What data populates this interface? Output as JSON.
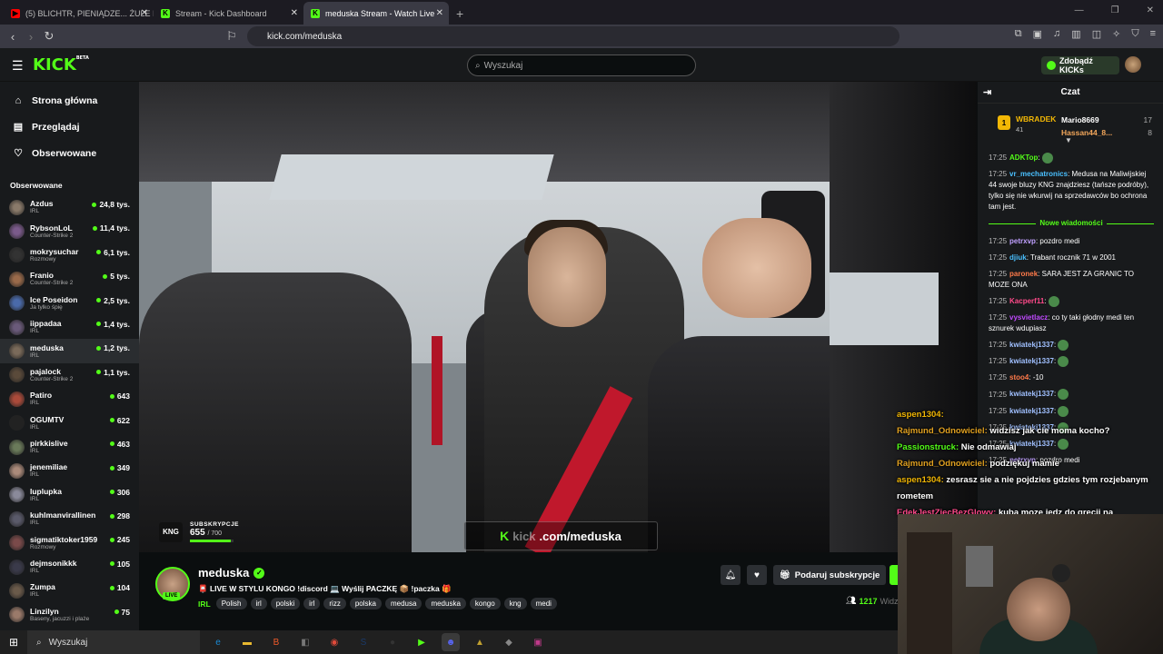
{
  "browser": {
    "tabs": [
      {
        "title": "(5) BLICHTR, PIENIĄDZE... ŻULE I BRU",
        "fav": "▶",
        "color": "#ff0000"
      },
      {
        "title": "Stream - Kick Dashboard",
        "fav": "K",
        "color": "#53fc18"
      },
      {
        "title": "meduska Stream - Watch Live",
        "fav": "K",
        "color": "#53fc18"
      }
    ],
    "url": "kick.com/meduska"
  },
  "header": {
    "search_placeholder": "Wyszukaj",
    "kicks_button": "Zdobądź KICKs"
  },
  "sidebar": {
    "nav": [
      {
        "label": "Strona główna",
        "icon": "home-icon",
        "glyph": "⌂"
      },
      {
        "label": "Przeglądaj",
        "icon": "browse-icon",
        "glyph": "▤"
      },
      {
        "label": "Obserwowane",
        "icon": "heart-icon",
        "glyph": "♡"
      }
    ],
    "section_title": "Obserwowane",
    "followed": [
      {
        "name": "Azdus",
        "category": "IRL",
        "viewers": "24,8 tys.",
        "color": "#8a7a6a"
      },
      {
        "name": "RybsonLoL",
        "category": "Counter-Strike 2",
        "viewers": "11,4 tys.",
        "color": "#7a5a8a"
      },
      {
        "name": "mokrysuchar",
        "category": "Rozmowy",
        "viewers": "6,1 tys.",
        "color": "#333"
      },
      {
        "name": "Franio",
        "category": "Counter-Strike 2",
        "viewers": "5 tys.",
        "color": "#9a6a4a"
      },
      {
        "name": "Ice Poseidon",
        "category": "Ja tylko śpię",
        "viewers": "2,5 tys.",
        "color": "#4a6aaa"
      },
      {
        "name": "iippadaa",
        "category": "IRL",
        "viewers": "1,4 tys.",
        "color": "#6a5a7a"
      },
      {
        "name": "meduska",
        "category": "IRL",
        "viewers": "1,2 tys.",
        "color": "#7a6a5a"
      },
      {
        "name": "pajalock",
        "category": "Counter-Strike 2",
        "viewers": "1,1 tys.",
        "color": "#5a4a3a"
      },
      {
        "name": "Patiro",
        "category": "IRL",
        "viewers": "643",
        "color": "#aa4a3a"
      },
      {
        "name": "OGUMTV",
        "category": "IRL",
        "viewers": "622",
        "color": "#222"
      },
      {
        "name": "pirkkislive",
        "category": "IRL",
        "viewers": "463",
        "color": "#6a7a5a"
      },
      {
        "name": "jenemiliae",
        "category": "IRL",
        "viewers": "349",
        "color": "#aa8a7a"
      },
      {
        "name": "luplupka",
        "category": "IRL",
        "viewers": "306",
        "color": "#8a8a9a"
      },
      {
        "name": "kuhlmanvirallinen",
        "category": "IRL",
        "viewers": "298",
        "color": "#5a5a6a"
      },
      {
        "name": "sigmatiktoker1959",
        "category": "Rozmowy",
        "viewers": "245",
        "color": "#7a4a4a"
      },
      {
        "name": "dejmsonikkk",
        "category": "IRL",
        "viewers": "105",
        "color": "#3a3a4a"
      },
      {
        "name": "Zumpa",
        "category": "IRL",
        "viewers": "104",
        "color": "#6a5a4a"
      },
      {
        "name": "Linzilyn",
        "category": "Baseny, jacuzzi i plaże",
        "viewers": "75",
        "color": "#9a7a6a"
      },
      {
        "name": "LittleElena",
        "category": "IRL",
        "viewers": "74",
        "color": "#aa7a8a"
      }
    ],
    "selected": "meduska"
  },
  "player": {
    "sub_widget_label": "SUBSKRYPCJE",
    "sub_logo": "KNG",
    "sub_current": "655",
    "sub_goal": "700",
    "sub_fraction": 0.936,
    "watermark_prefix": "kick",
    "watermark_text": ".com/meduska",
    "overlay_chat": [
      {
        "user": "aspen1304",
        "text": "",
        "color": "#f2b705"
      },
      {
        "user": "Rajmund_Odnowiciel",
        "text": "widzisz jak cie moma kocho?",
        "color": "#e0a020"
      },
      {
        "user": "Passionstruck",
        "text": "Nie odmawiaj",
        "color": "#53fc18"
      },
      {
        "user": "Rajmund_Odnowiciel",
        "text": "podziękuj mamie",
        "color": "#e0a020"
      },
      {
        "user": "aspen1304",
        "text": "zesrasz sie a nie pojdzies gdzies tym rozjebanym rometem",
        "color": "#f2b705"
      },
      {
        "user": "EdekJestZiecBezGlowy",
        "text": "kuba moze jedz do grecji na",
        "color": "#ff4a8a"
      }
    ]
  },
  "stream_info": {
    "name": "meduska",
    "live": "LIVE",
    "title": "📮 LIVE W STYLU KONGO !discord 💻 Wyślij PACZKĘ 📦 !paczka 🎁",
    "category": "IRL",
    "tags": [
      "Polish",
      "irl",
      "polski",
      "irl",
      "rizz",
      "polska",
      "medusa",
      "meduska",
      "kongo",
      "kng",
      "medi"
    ],
    "gift_label": "Podaruj subskrypcje",
    "viewers": "1217",
    "viewers_suffix": "Widz"
  },
  "chat": {
    "title": "Czat",
    "leaderboard": {
      "top_rank": "1",
      "top_user": "WBRADEK",
      "top_count": "41",
      "others": [
        {
          "user": "Mario8669",
          "count": "17"
        },
        {
          "user": "Hassan44_8...",
          "count": "8"
        }
      ]
    },
    "new_messages_label": "Nowe wiadomości",
    "messages_before": [
      {
        "time": "17:25",
        "user": "ADKTop",
        "text": "",
        "color": "#53fc18"
      },
      {
        "time": "17:25",
        "user": "vr_mechatronics",
        "text": "Medusa na Maliwijskiej 44 swoje bluzy KNG znajdziesz (tańsze podróby), tylko się nie wkurwij na sprzedawców bo ochrona tam jest.",
        "color": "#4ac0ff"
      }
    ],
    "messages_after": [
      {
        "time": "17:25",
        "user": "petrxvp",
        "text": "pozdro medi",
        "color": "#c0a0ff"
      },
      {
        "time": "17:25",
        "user": "djiuk",
        "text": "Trabant rocznik 71 w 2001",
        "color": "#4ac0ff"
      },
      {
        "time": "17:25",
        "user": "paronek",
        "text": "SARA JEST ZA GRANIC TO MOZE ONA",
        "color": "#ff7a4a"
      },
      {
        "time": "17:25",
        "user": "Kacperf11",
        "text": "",
        "color": "#ff4a8a"
      },
      {
        "time": "17:25",
        "user": "vysvietlacz",
        "text": "co ty taki głodny medi ten sznurek wdupiasz",
        "color": "#c04aff"
      },
      {
        "time": "17:25",
        "user": "kwiatekj1337",
        "text": "",
        "color": "#a0c0ff"
      },
      {
        "time": "17:25",
        "user": "kwiatekj1337",
        "text": "",
        "color": "#a0c0ff"
      },
      {
        "time": "17:25",
        "user": "stoo4",
        "text": "-10",
        "color": "#ff7a4a"
      },
      {
        "time": "17:25",
        "user": "kwiatekj1337",
        "text": "",
        "color": "#a0c0ff"
      },
      {
        "time": "17:25",
        "user": "kwiatekj1337",
        "text": "",
        "color": "#a0c0ff"
      },
      {
        "time": "17:25",
        "user": "kwiatekj1337",
        "text": "",
        "color": "#a0c0ff"
      },
      {
        "time": "17:25",
        "user": "kwiatekj1337",
        "text": "",
        "color": "#a0c0ff"
      },
      {
        "time": "17:25",
        "user": "petrxvp",
        "text": "pozdro medi",
        "color": "#c0a0ff"
      }
    ]
  },
  "taskbar": {
    "search_label": "Wyszukaj",
    "apps": [
      {
        "name": "edge-icon",
        "glyph": "e",
        "color": "#1a8ad4"
      },
      {
        "name": "explorer-icon",
        "glyph": "▬",
        "color": "#e8b830"
      },
      {
        "name": "brave-icon",
        "glyph": "B",
        "color": "#f05a2a"
      },
      {
        "name": "app-icon",
        "glyph": "◧",
        "color": "#777"
      },
      {
        "name": "chrome-icon",
        "glyph": "◉",
        "color": "#e04a3a"
      },
      {
        "name": "steam-icon",
        "glyph": "S",
        "color": "#1a3a6a"
      },
      {
        "name": "obs-icon",
        "glyph": "●",
        "color": "#333"
      },
      {
        "name": "kick-icon",
        "glyph": "▶",
        "color": "#53fc18"
      },
      {
        "name": "discord-icon",
        "glyph": "☻",
        "color": "#5865f2"
      },
      {
        "name": "app2-icon",
        "glyph": "▲",
        "color": "#c0a030"
      },
      {
        "name": "app3-icon",
        "glyph": "◆",
        "color": "#888"
      },
      {
        "name": "app4-icon",
        "glyph": "▣",
        "color": "#c03a8a"
      }
    ]
  },
  "accent": "#53fc18"
}
